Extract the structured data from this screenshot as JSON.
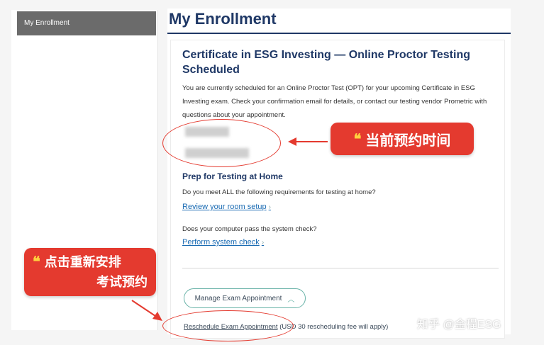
{
  "sidebar": {
    "items": [
      {
        "label": "My Enrollment"
      }
    ]
  },
  "main": {
    "page_title": "My Enrollment",
    "card": {
      "title": "Certificate in ESG Investing — Online Proctor Testing Scheduled",
      "description": "You are currently scheduled for an Online Proctor Test (OPT) for your upcoming Certificate in ESG Investing exam. Check your confirmation email for details, or contact our testing vendor Prometric with questions about your appointment.",
      "section_title": "Prep for Testing at Home",
      "question1": "Do you meet ALL the following requirements for testing at home?",
      "link1": "Review your room setup",
      "question2": "Does your computer pass the system check?",
      "link2": "Perform system check",
      "manage_button": "Manage Exam Appointment",
      "reschedule_link": "Reschedule Exam Appointment",
      "reschedule_note": "(USD 30 rescheduling fee will apply)"
    }
  },
  "annotations": {
    "tag1": "当前预约时间",
    "tag2_line1": "点击重新安排",
    "tag2_line2": "考试预约",
    "accent_color": "#e43a2f",
    "quote_color": "#ffd23f"
  },
  "watermark": "知乎 @金程ESG"
}
